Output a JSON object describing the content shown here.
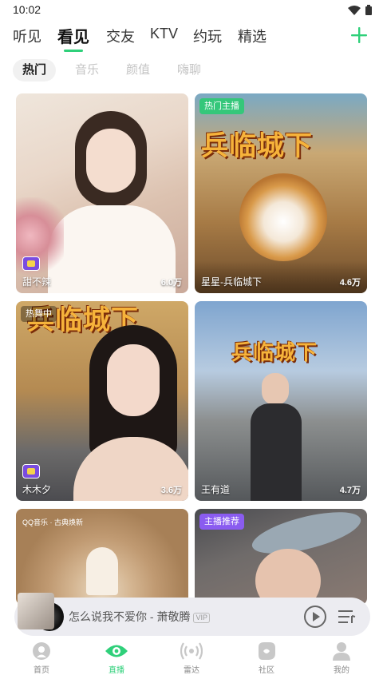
{
  "status_bar": {
    "time": "10:02"
  },
  "top_tabs": [
    {
      "label": "听见"
    },
    {
      "label": "看见",
      "active": true
    },
    {
      "label": "交友"
    },
    {
      "label": "KTV"
    },
    {
      "label": "约玩"
    },
    {
      "label": "精选"
    }
  ],
  "sub_tabs": [
    {
      "label": "热门",
      "active": true
    },
    {
      "label": "音乐"
    },
    {
      "label": "颜值"
    },
    {
      "label": "嗨聊"
    }
  ],
  "cards": [
    {
      "name": "甜不辣",
      "count": "6.0万",
      "tag": ""
    },
    {
      "name": "星星-兵临城下",
      "count": "4.6万",
      "tag": "热门主播",
      "banner": "兵临城下"
    },
    {
      "name": "木木夕",
      "count": "3.6万",
      "tag": "热舞中",
      "banner": "兵临城下"
    },
    {
      "name": "王有道",
      "count": "4.7万",
      "tag": "",
      "banner": "兵临城下"
    },
    {
      "name": "",
      "count": "",
      "tag": "",
      "qq_label": "QQ音乐 · 古典焕新"
    },
    {
      "name": "",
      "count": "",
      "tag": "主播推荐"
    }
  ],
  "mini_player": {
    "title": "怎么说我不爱你 - 萧敬腾",
    "vip": "VIP"
  },
  "bottom_nav": [
    {
      "label": "首页",
      "icon": "home-icon"
    },
    {
      "label": "直播",
      "icon": "live-eye-icon",
      "active": true
    },
    {
      "label": "雷达",
      "icon": "radar-icon"
    },
    {
      "label": "社区",
      "icon": "community-icon"
    },
    {
      "label": "我的",
      "icon": "profile-icon"
    }
  ],
  "colors": {
    "accent": "#2fd07a",
    "tag_green": "#35c77a",
    "tag_purple": "#8a5cf0"
  }
}
